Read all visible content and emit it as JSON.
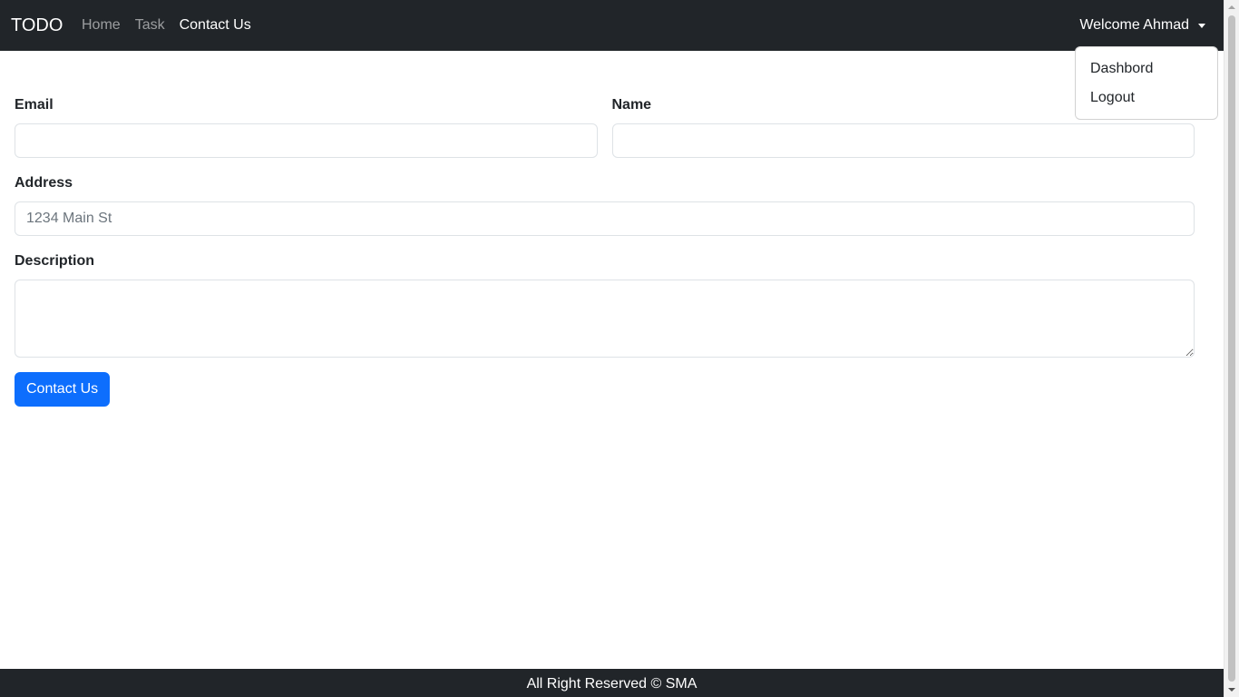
{
  "navbar": {
    "brand": "TODO",
    "links": [
      {
        "label": "Home",
        "active": false
      },
      {
        "label": "Task",
        "active": false
      },
      {
        "label": "Contact Us",
        "active": true
      }
    ],
    "user_menu_label": "Welcome Ahmad"
  },
  "dropdown": {
    "items": [
      "Dashbord",
      "Logout"
    ]
  },
  "form": {
    "email_label": "Email",
    "email_value": "",
    "name_label": "Name",
    "name_value": "",
    "address_label": "Address",
    "address_placeholder": "1234 Main St",
    "address_value": "",
    "description_label": "Description",
    "description_value": "",
    "submit_label": "Contact Us"
  },
  "footer": {
    "text": "All Right Reserved © SMA"
  },
  "colors": {
    "navbar_bg": "#212529",
    "primary": "#0d6efd"
  }
}
